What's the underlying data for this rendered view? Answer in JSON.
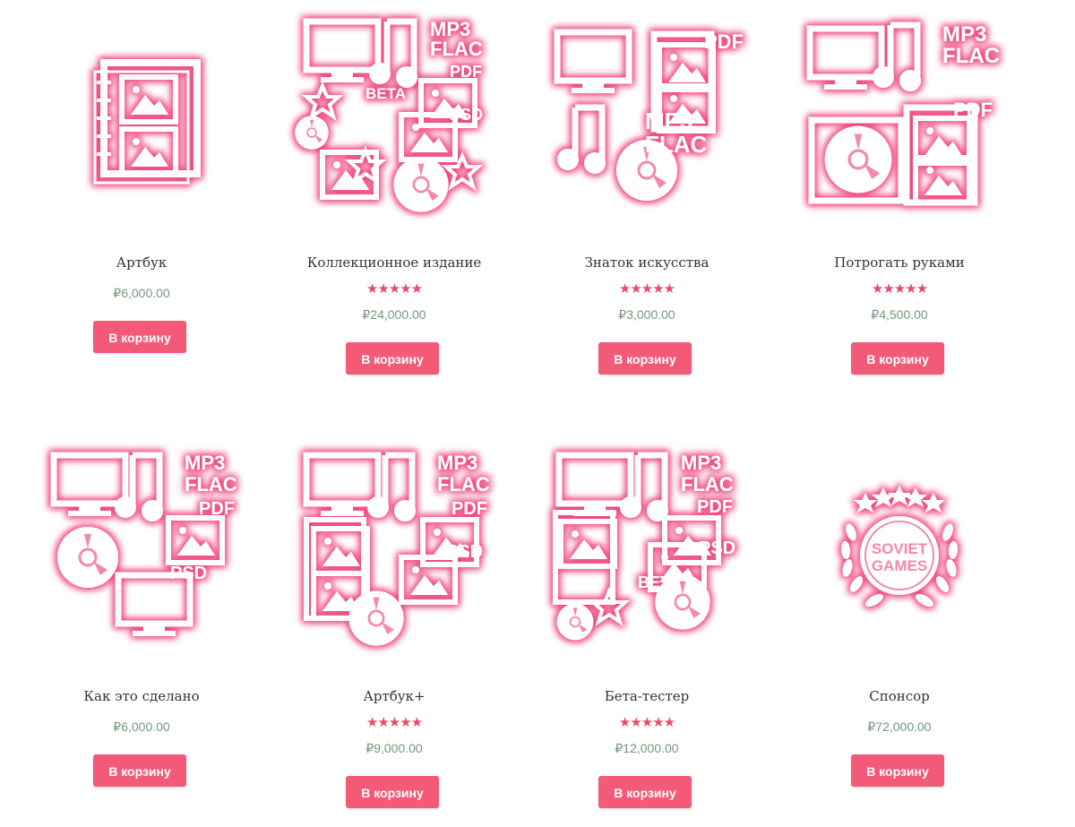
{
  "colors": {
    "accent": "#f25a77",
    "star": "#e84a6a",
    "price": "#72997a",
    "title": "#333333",
    "glow": "#f0457a"
  },
  "products": [
    {
      "title": "Артбук",
      "price": "₽6,000.00",
      "rating": null,
      "button": "В корзину",
      "icon": "artbook-icon"
    },
    {
      "title": "Коллекционное издание",
      "price": "₽24,000.00",
      "rating": "★★★★★",
      "button": "В корзину",
      "icon": "collectors-bundle-icon",
      "icon_labels": {
        "mp3": "MP3",
        "flac": "FLAC",
        "pdf": "PDF",
        "beta": "BETA",
        "psd": "PSD"
      }
    },
    {
      "title": "Знаток искусства",
      "price": "₽3,000.00",
      "rating": "★★★★★",
      "button": "В корзину",
      "icon": "art-connoisseur-icon",
      "icon_labels": {
        "pdf": "PDF",
        "mp3": "MP3",
        "flac": "FLAC"
      }
    },
    {
      "title": "Потрогать руками",
      "price": "₽4,500.00",
      "rating": "★★★★★",
      "button": "В корзину",
      "icon": "physical-bundle-icon",
      "icon_labels": {
        "mp3": "MP3",
        "flac": "FLAC",
        "pdf": "PDF"
      }
    },
    {
      "title": "Как это сделано",
      "price": "₽6,000.00",
      "rating": null,
      "button": "В корзину",
      "icon": "making-of-icon",
      "icon_labels": {
        "mp3": "MP3",
        "flac": "FLAC",
        "pdf": "PDF",
        "psd": "PSD"
      }
    },
    {
      "title": "Артбук+",
      "price": "₽9,000.00",
      "rating": "★★★★★",
      "button": "В корзину",
      "icon": "artbook-plus-icon",
      "icon_labels": {
        "mp3": "MP3",
        "flac": "FLAC",
        "pdf": "PDF",
        "psd": "PSD"
      }
    },
    {
      "title": "Бета-тестер",
      "price": "₽12,000.00",
      "rating": "★★★★★",
      "button": "В корзину",
      "icon": "beta-tester-icon",
      "icon_labels": {
        "mp3": "MP3",
        "flac": "FLAC",
        "pdf": "PDF",
        "psd": "PSD",
        "beta": "BETA"
      }
    },
    {
      "title": "Спонсор",
      "price": "₽72,000.00",
      "rating": null,
      "button": "В корзину",
      "icon": "sponsor-badge-icon",
      "icon_labels": {
        "line1": "SOVIET",
        "line2": "GAMES"
      }
    }
  ]
}
